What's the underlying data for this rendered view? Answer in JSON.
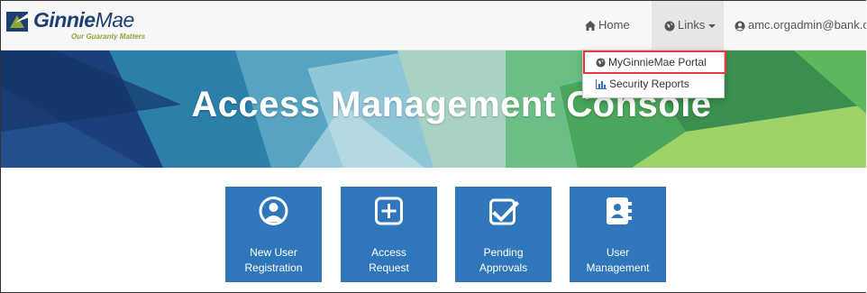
{
  "brand": {
    "name_bold": "Ginnie",
    "name_regular": "Mae",
    "tagline": "Our Guaranty Matters"
  },
  "nav": {
    "home_label": "Home",
    "links_label": "Links",
    "user_label": "amc.orgadmin@bank.com"
  },
  "dropdown": {
    "items": [
      {
        "label": "MyGinnieMae Portal",
        "icon": "globe-icon",
        "highlighted": true
      },
      {
        "label": "Security Reports",
        "icon": "bar-chart-icon",
        "highlighted": false
      }
    ]
  },
  "banner": {
    "title": "Access Management Console"
  },
  "tiles": [
    {
      "line1": "New User",
      "line2": "Registration",
      "icon": "user-circle-icon"
    },
    {
      "line1": "Access",
      "line2": "Request",
      "icon": "plus-square-icon"
    },
    {
      "line1": "Pending",
      "line2": "Approvals",
      "icon": "check-square-icon"
    },
    {
      "line1": "User",
      "line2": "Management",
      "icon": "address-book-icon"
    }
  ],
  "colors": {
    "brand_navy": "#1b3f73",
    "tagline_green": "#8aa63a",
    "tile_blue": "#2f77ba",
    "highlight_red": "#e53b3b"
  }
}
